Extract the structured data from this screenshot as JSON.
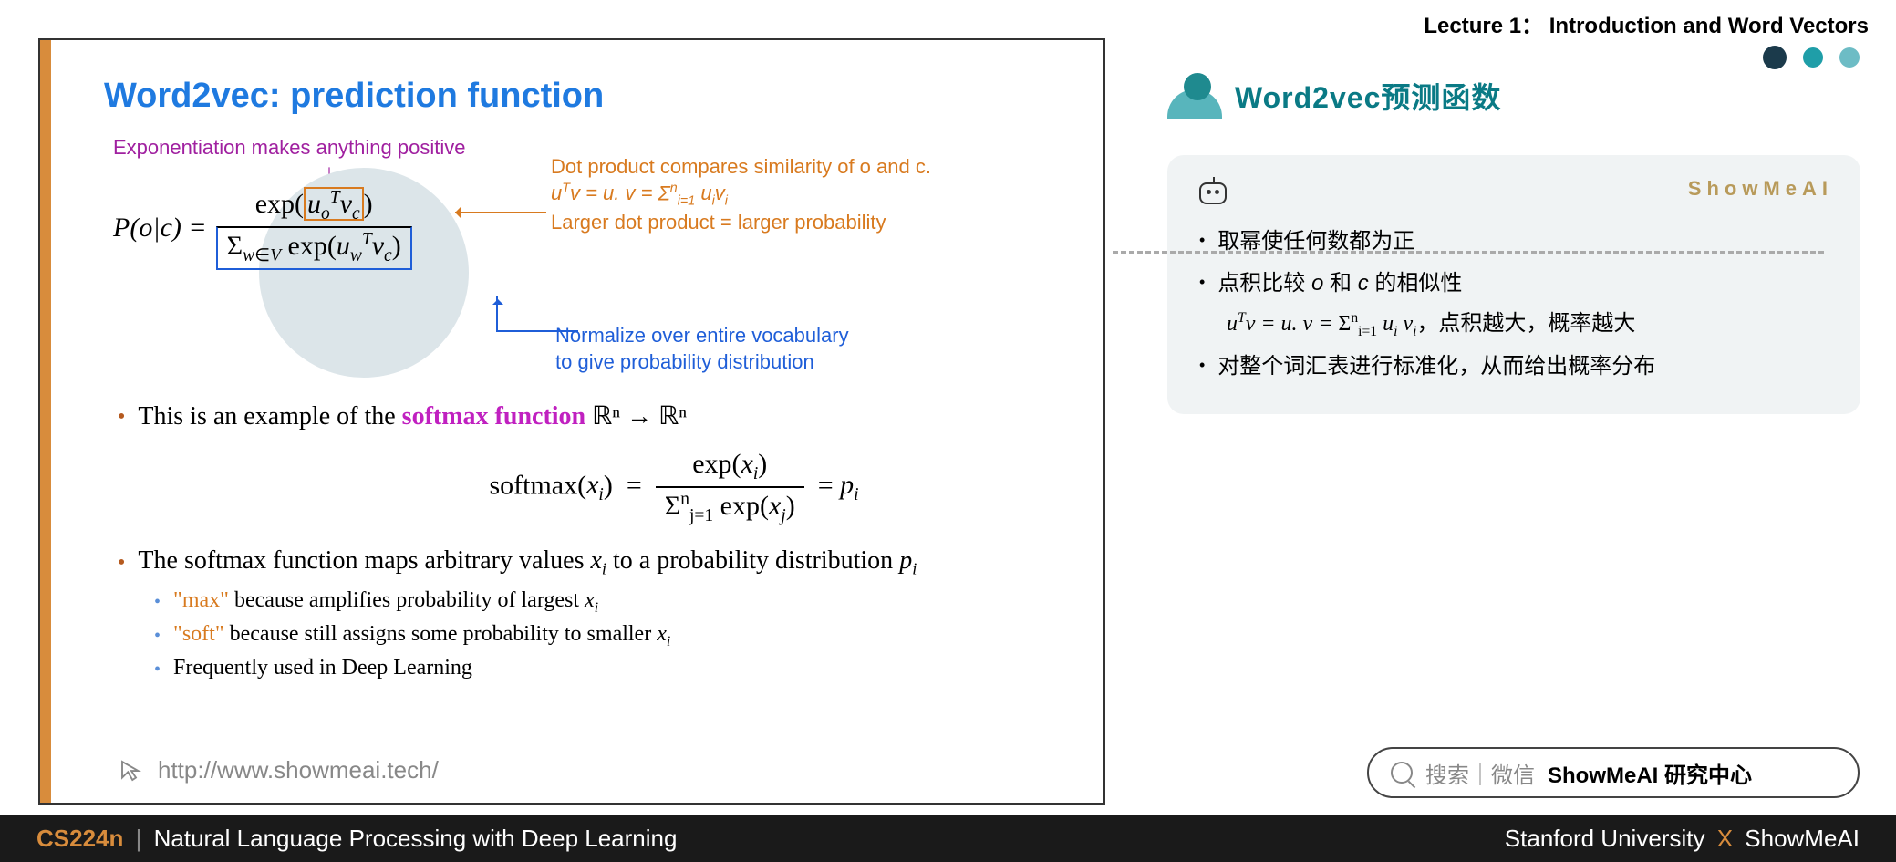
{
  "header": {
    "lecture": "Lecture 1： Introduction and Word Vectors"
  },
  "slide": {
    "title": "Word2vec: prediction function",
    "annot_purple": "Exponentiation makes anything positive",
    "annot_orange_l1": "Dot product compares similarity of o and c.",
    "annot_orange_l2": "uᵀv = u. v = Σⁿᵢ₌₁ uᵢvᵢ",
    "annot_orange_l3": "Larger dot product = larger probability",
    "annot_blue_l1": "Normalize over entire vocabulary",
    "annot_blue_l2": "to give probability distribution",
    "formula_lhs": "P(o|c) =",
    "formula_num_a": "exp(",
    "formula_num_b": "uₒᵀv꜀",
    "formula_num_c": ")",
    "formula_den": "Σ_{w∈V} exp(u_wᵀv꜀)",
    "bullet1_a": "This is an example of the ",
    "bullet1_b": "softmax function",
    "bullet1_c": " ℝⁿ → ℝⁿ",
    "softmax_formula": "softmax(xᵢ) =  exp(xᵢ) / Σⁿⱼ₌₁ exp(xⱼ)  = pᵢ",
    "bullet2": "The softmax function maps arbitrary values xᵢ to a probability distribution pᵢ",
    "sub1_a": "\"max\"",
    "sub1_b": " because amplifies probability of largest xᵢ",
    "sub2_a": "\"soft\"",
    "sub2_b": " because still assigns some probability to smaller xᵢ",
    "sub3": "Frequently used in Deep Learning",
    "link": "http://www.showmeai.tech/"
  },
  "right": {
    "title": "Word2vec预测函数",
    "brand": "ShowMeAI",
    "b1": "取幂使任何数都为正",
    "b2": "点积比较 o 和 c 的相似性",
    "b2_math": "uᵀv = u. v = Σⁿᵢ₌₁ uᵢ vᵢ，点积越大，概率越大",
    "b3": "对整个词汇表进行标准化，从而给出概率分布"
  },
  "search": {
    "gray": "搜索｜微信",
    "bold": "ShowMeAI 研究中心"
  },
  "footer": {
    "course": "CS224n",
    "subtitle": "Natural Language Processing with Deep Learning",
    "right_a": "Stanford University",
    "right_b": "ShowMeAI"
  }
}
